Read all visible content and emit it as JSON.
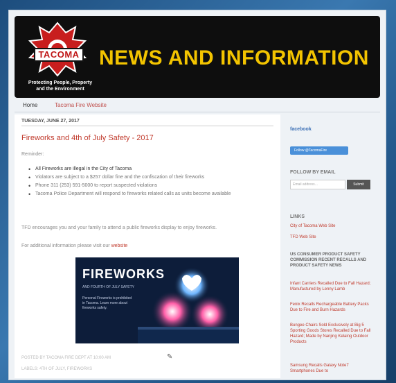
{
  "header": {
    "logo_name": "TACOMA",
    "tagline": "Protecting People, Property and the Environment",
    "title": "NEWS AND INFORMATION"
  },
  "nav": {
    "home": "Home",
    "tab": "Tacoma Fire Website"
  },
  "post": {
    "date": "TUESDAY, JUNE 27, 2017",
    "title": "Fireworks and 4th of July Safety - 2017",
    "greeting": "Reminder:",
    "bullets": [
      "All Fireworks are illegal in the City of Tacoma",
      "Violators are subject to a $257 dollar fine and the confiscation of their fireworks",
      "Phone 311 (253) 591-5000 to report suspected violations",
      "Tacoma Police Department will respond to fireworks related calls as units become available"
    ],
    "paragraph": "TFD encourages you and your family to attend a public fireworks display to enjoy fireworks.",
    "more_info": "For additional information please visit our",
    "more_info_link": "website",
    "footer1": "POSTED BY TACOMA FIRE DEPT AT 10:00 AM",
    "footer2": "LABELS: 4TH OF JULY, FIREWORKS"
  },
  "promo": {
    "title": "FIREWORKS",
    "subtitle": "AND FOURTH OF JULY SAFETY",
    "text": "Personal Fireworks is prohibited in Tacoma. Learn more about fireworks safety."
  },
  "sidebar": {
    "facebook_head": "facebook",
    "facebook_button": "Follow @TacomaFire",
    "email_head": "FOLLOW BY EMAIL",
    "email_placeholder": "Email address...",
    "submit": "Submit",
    "links_head": "LINKS",
    "link1": "City of Tacoma Web Site",
    "link2": "TFD Web Site",
    "recalls_head": "US CONSUMER PRODUCT SAFETY COMMISSION RECENT RECALLS AND PRODUCT SAFETY NEWS",
    "items": [
      "Infant Carriers Recalled Due to Fall Hazard; Manufactured by Lenny Lamb",
      "Fenix Recalls Rechargeable Battery Packs Due to Fire and Burn Hazards",
      "Bungee Chairs Sold Exclusively at Big 5 Sporting Goods Stores Recalled Due to Fall Hazard; Made by Nanjing Kelaing Outdoor Products",
      "Samsung Recalls Galaxy Note7 Smartphones Due to"
    ]
  },
  "colors": {
    "title_gold": "#f3c400",
    "link_red": "#c0392b",
    "header_black": "#0e0e0e"
  }
}
